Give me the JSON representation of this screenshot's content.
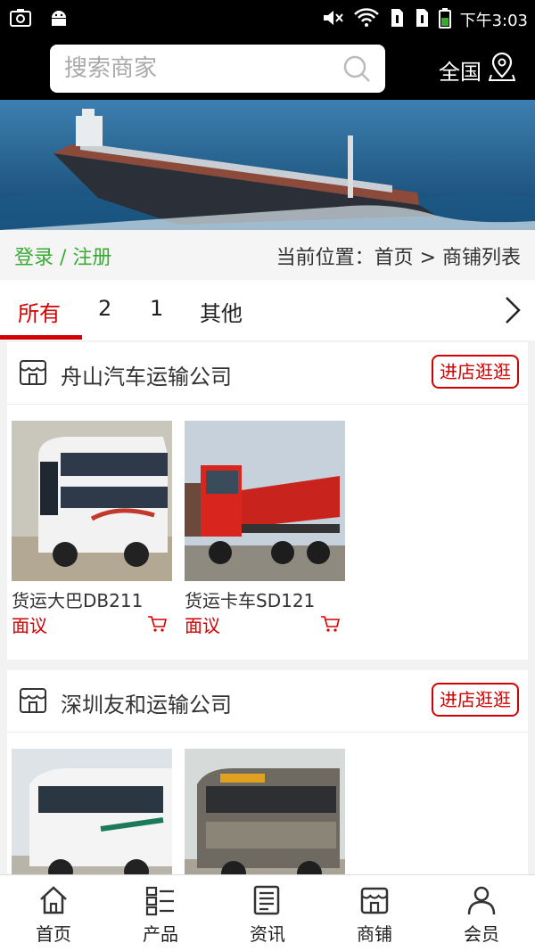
{
  "status_bar": {
    "time": "下午3:03",
    "icons": [
      "screenshot-icon",
      "android-icon",
      "mute-icon",
      "wifi-icon",
      "sim-icon",
      "sim-icon",
      "battery-icon"
    ]
  },
  "header": {
    "search_placeholder": "搜索商家",
    "region_label": "全国"
  },
  "breadcrumb": {
    "login_label": "登录 / 注册",
    "location_text": "当前位置：首页 > 商铺列表"
  },
  "tabs": [
    {
      "label": "所有",
      "active": true
    },
    {
      "label": "2"
    },
    {
      "label": "1"
    },
    {
      "label": "其他"
    }
  ],
  "shops": [
    {
      "name": "舟山汽车运输公司",
      "visit_label": "进店逛逛",
      "products": [
        {
          "name": "货运大巴DB211",
          "price": "面议"
        },
        {
          "name": "货运卡车SD121",
          "price": "面议"
        }
      ]
    },
    {
      "name": "深圳友和运输公司",
      "visit_label": "进店逛逛",
      "products": [
        {
          "name": "",
          "price": ""
        },
        {
          "name": "",
          "price": ""
        }
      ]
    }
  ],
  "bottom_nav": [
    {
      "label": "首页",
      "icon": "home-icon"
    },
    {
      "label": "产品",
      "icon": "products-icon"
    },
    {
      "label": "资讯",
      "icon": "news-icon"
    },
    {
      "label": "商铺",
      "icon": "store-icon"
    },
    {
      "label": "会员",
      "icon": "member-icon"
    }
  ],
  "colors": {
    "accent": "#d40000",
    "login_green": "#3aaa35",
    "header_bg": "#000000"
  }
}
